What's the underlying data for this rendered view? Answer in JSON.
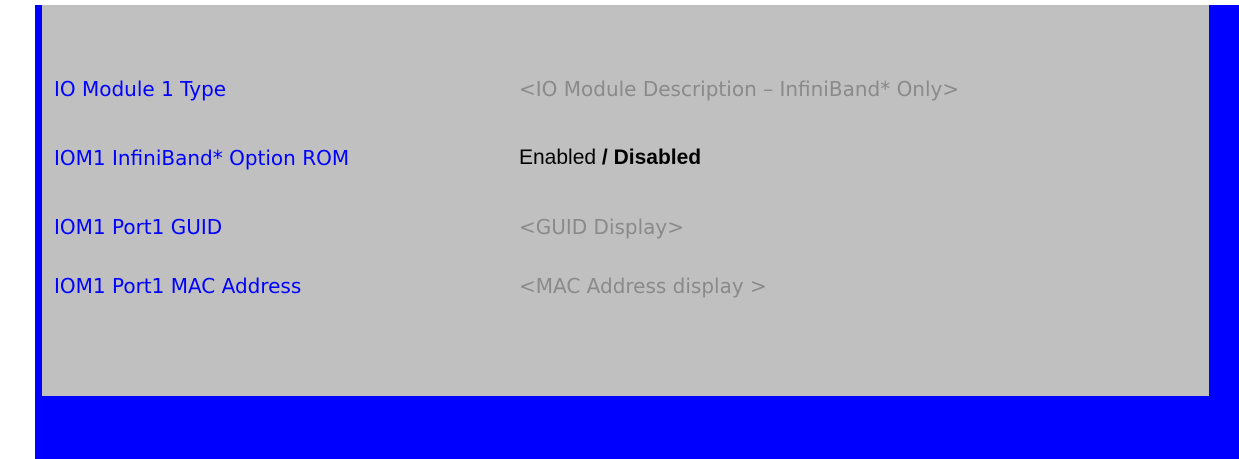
{
  "colors": {
    "background": "#0000ff",
    "panel": "#c0c0c0",
    "label_text": "#0000ff",
    "info_text": "#8a8a8a",
    "option_text": "#000000"
  },
  "settings": [
    {
      "label": "IO Module 1 Type",
      "value": "<IO Module Description – InfiniBand* Only>"
    },
    {
      "label": "IOM1 InfiniBand* Option ROM",
      "options": [
        "Enabled",
        "Disabled"
      ],
      "separator": " / ",
      "selected": "Disabled"
    },
    {
      "label": "IOM1 Port1 GUID",
      "value": "<GUID Display>"
    },
    {
      "label": "IOM1 Port1 MAC Address",
      "value": "<MAC Address display >"
    }
  ]
}
